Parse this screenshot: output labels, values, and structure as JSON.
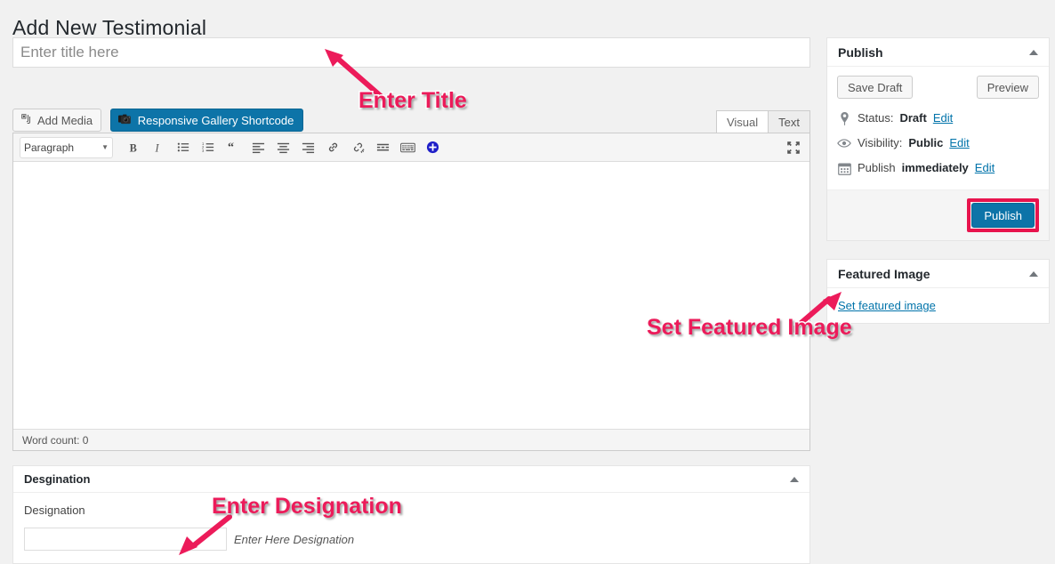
{
  "page": {
    "title": "Add New Testimonial"
  },
  "title_field": {
    "placeholder": "Enter title here",
    "value": ""
  },
  "media_row": {
    "add_media_label": "Add Media",
    "add_media_icon": "media-icon",
    "shortcode_label": "Responsive Gallery Shortcode",
    "shortcode_icon": "camera-icon",
    "shortcode_bg": "#0d74a8"
  },
  "editor_tabs": [
    {
      "label": "Visual",
      "active": true
    },
    {
      "label": "Text",
      "active": false
    }
  ],
  "editor": {
    "format_select_value": "Paragraph",
    "toolbar_icons": [
      "bold-icon",
      "italic-icon",
      "bulleted-list-icon",
      "numbered-list-icon",
      "blockquote-icon",
      "align-left-icon",
      "align-center-icon",
      "align-right-icon",
      "insert-link-icon",
      "unlink-icon",
      "insert-read-more-icon",
      "keyboard-shortcuts-icon",
      "toolbar-toggle-plus-icon"
    ],
    "distraction_free_icon": "distraction-free-writing-icon",
    "content": "",
    "word_count": "Word count: 0"
  },
  "designation_box": {
    "panel_title": "Desgination",
    "toggle_icon": "collapse-arrow-icon",
    "field_label": "Designation",
    "field_value": "",
    "field_hint": "Enter Here Designation"
  },
  "publish_panel": {
    "title": "Publish",
    "toggle_icon": "collapse-arrow-icon",
    "save_draft_label": "Save Draft",
    "preview_label": "Preview",
    "status": {
      "icon": "post-status-pin-icon",
      "label": "Status:",
      "value": "Draft",
      "edit_label": "Edit"
    },
    "visibility": {
      "icon": "visibility-eye-icon",
      "label": "Visibility:",
      "value": "Public",
      "edit_label": "Edit"
    },
    "schedule": {
      "icon": "calendar-icon",
      "label": "Publish",
      "value": "immediately",
      "edit_label": "Edit"
    },
    "publish_button_label": "Publish",
    "publish_button_bg": "#0d74a8",
    "highlight_color": "#e8144d"
  },
  "featured_image_panel": {
    "title": "Featured Image",
    "toggle_icon": "collapse-arrow-icon",
    "set_link_label": "Set featured image"
  },
  "annotations": [
    {
      "id": "enter-title",
      "text": "Enter Title",
      "color": "#ec1b5a"
    },
    {
      "id": "set-featured-image",
      "text": "Set Featured Image",
      "color": "#ec1b5a"
    },
    {
      "id": "enter-designation",
      "text": "Enter Designation",
      "color": "#ec1b5a"
    }
  ]
}
